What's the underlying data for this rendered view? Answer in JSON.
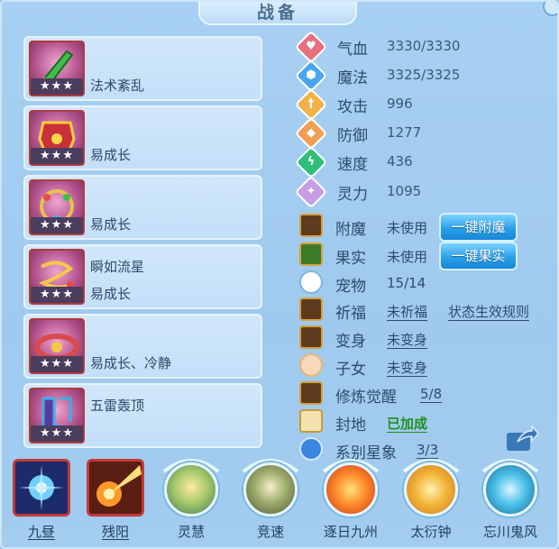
{
  "title": "战备",
  "equipment": [
    {
      "stars": "★★★",
      "lines": [
        "",
        "法术紊乱"
      ]
    },
    {
      "stars": "★★★",
      "lines": [
        "",
        "易成长"
      ]
    },
    {
      "stars": "★★★",
      "lines": [
        "",
        "易成长"
      ]
    },
    {
      "stars": "★★★",
      "lines": [
        "瞬如流星",
        "易成长"
      ]
    },
    {
      "stars": "★★★",
      "lines": [
        "",
        "易成长、冷静"
      ]
    },
    {
      "stars": "★★★",
      "lines": [
        "五雷轰顶",
        ""
      ]
    }
  ],
  "stats": [
    {
      "icon": "heart-icon",
      "color": "#e8707e",
      "label": "气血",
      "value": "3330/3330"
    },
    {
      "icon": "hexagon-icon",
      "color": "#4aa6ee",
      "label": "魔法",
      "value": "3325/3325"
    },
    {
      "icon": "sword-icon",
      "color": "#f1b24a",
      "label": "攻击",
      "value": "996"
    },
    {
      "icon": "shield-icon",
      "color": "#f0a055",
      "label": "防御",
      "value": "1277"
    },
    {
      "icon": "lightning-icon",
      "color": "#2fbf7a",
      "label": "速度",
      "value": "436"
    },
    {
      "icon": "spirit-icon",
      "color": "#c89be6",
      "label": "灵力",
      "value": "1095"
    }
  ],
  "features": {
    "enchant": {
      "label": "附魔",
      "value": "未使用",
      "button": "一键附魔"
    },
    "fruit": {
      "label": "果实",
      "value": "未使用",
      "button": "一键果实"
    },
    "pet": {
      "label": "宠物",
      "value": "15/14"
    },
    "blessing": {
      "label": "祈福",
      "value": "未祈福",
      "link": "状态生效规则"
    },
    "transform": {
      "label": "变身",
      "value": "未变身"
    },
    "child": {
      "label": "子女",
      "value": "未变身"
    },
    "cultivation": {
      "label": "修炼觉醒",
      "value": "5/8"
    },
    "fief": {
      "label": "封地",
      "value": "已加成"
    },
    "constellation": {
      "label": "系别星象",
      "value": "3/3"
    }
  },
  "skills": [
    {
      "name": "九昼",
      "style": "square"
    },
    {
      "name": "残阳",
      "style": "square"
    },
    {
      "name": "灵慧",
      "style": "round"
    },
    {
      "name": "竞速",
      "style": "round"
    },
    {
      "name": "逐日九州",
      "style": "round"
    },
    {
      "name": "太衍钟",
      "style": "round"
    },
    {
      "name": "忘川鬼风",
      "style": "round"
    }
  ]
}
